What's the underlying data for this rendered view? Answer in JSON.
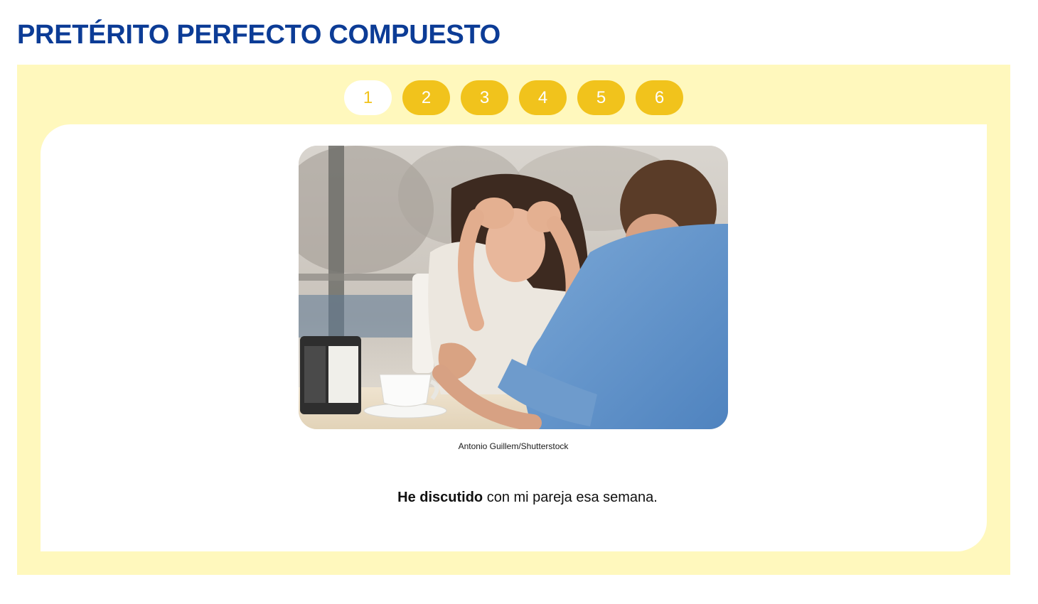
{
  "page": {
    "title": "PRETÉRITO PERFECTO COMPUESTO"
  },
  "tabs": {
    "items": [
      {
        "label": "1",
        "active": true
      },
      {
        "label": "2",
        "active": false
      },
      {
        "label": "3",
        "active": false
      },
      {
        "label": "4",
        "active": false
      },
      {
        "label": "5",
        "active": false
      },
      {
        "label": "6",
        "active": false
      }
    ]
  },
  "slide": {
    "image_credit": "Antonio Guillem/Shutterstock",
    "sentence_bold": "He discutido",
    "sentence_rest": " con mi pareja esa semana."
  },
  "colors": {
    "title": "#0c3c96",
    "panel_bg": "#fff8bd",
    "tab_bg": "#f1c31c",
    "tab_active_bg": "#ffffff"
  }
}
